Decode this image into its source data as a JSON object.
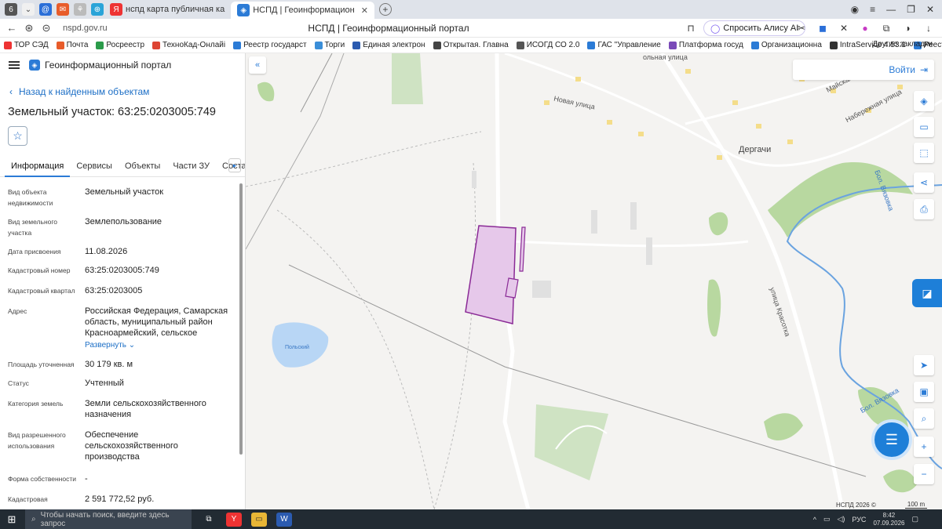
{
  "browser": {
    "tabs": [
      {
        "label": "нспд карта публичная ка",
        "icon": "yandex-icon",
        "active": false
      },
      {
        "label": "НСПД | Геоинформацион",
        "icon": "nspd-icon",
        "active": true
      }
    ],
    "url": "nspd.gov.ru",
    "page_title": "НСПД | Геоинформационный портал",
    "alice_label": "Спросить Алису AI",
    "bookmarks": [
      "ТОР СЭД",
      "Почта",
      "Росреестр",
      "ТехноКад-Онлайі",
      "Реестр государст",
      "Торги",
      "Единая электрон",
      "Открытая. Главна",
      "ИСОГД СО 2.0",
      "ГАС \"Управление",
      "Платформа госуд",
      "Организационна",
      "IntraService 4.53.1",
      "Реестр госуда"
    ],
    "bookmarks_more": "Другие закладки"
  },
  "portal": {
    "name": "Геоинформационный портал",
    "back_label": "Назад к найденным объектам",
    "object_title": "Земельный участок: 63:25:0203005:749",
    "tabs": [
      "Информация",
      "Сервисы",
      "Объекты",
      "Части ЗУ",
      "Состав"
    ],
    "properties": [
      {
        "key": "Вид объекта недвижимости",
        "value": "Земельный участок"
      },
      {
        "key": "Вид земельного участка",
        "value": "Землепользование"
      },
      {
        "key": "Дата присвоения",
        "value": "11.08.2026"
      },
      {
        "key": "Кадастровый номер",
        "value": "63:25:0203005:749"
      },
      {
        "key": "Кадастровый квартал",
        "value": "63:25:0203005"
      },
      {
        "key": "Адрес",
        "value": "Российская Федерация, Самарская область, муниципальный район Красноармейский, сельское"
      },
      {
        "key": "Площадь уточненная",
        "value": "30 179 кв. м"
      },
      {
        "key": "Статус",
        "value": "Учтенный"
      },
      {
        "key": "Категория земель",
        "value": "Земли сельскохозяйственного назначения"
      },
      {
        "key": "Вид разрешенного использования",
        "value": "Обеспечение сельскохозяйственного производства"
      },
      {
        "key": "Форма собственности",
        "value": "-"
      },
      {
        "key": "Кадастровая",
        "value": "2 591 772,52 руб."
      }
    ],
    "expand_label": "Развернуть"
  },
  "map": {
    "login_label": "Войти",
    "labels": {
      "street1": "Новая улица",
      "street2": "Набережная улица",
      "street3": "улица Красотка",
      "street4": "Майская",
      "street5": "ольная улица",
      "village": "Дергачи",
      "river1": "Бол. Вязовка",
      "river2": "Бол. Вязовка",
      "lake": "Польский"
    },
    "copyright": "НСПД 2026 ©",
    "scale": "100 m",
    "colors": {
      "parcel_fill": "#e6c8ea",
      "parcel_stroke": "#8a2a96",
      "water": "#b8d6f5",
      "green": "#cfe3c3",
      "building": "#f4dd8a"
    }
  },
  "taskbar": {
    "search_placeholder": "Чтобы начать поиск, введите здесь запрос",
    "lang": "РУС",
    "time": "8:42",
    "date": "07.09.2026"
  }
}
